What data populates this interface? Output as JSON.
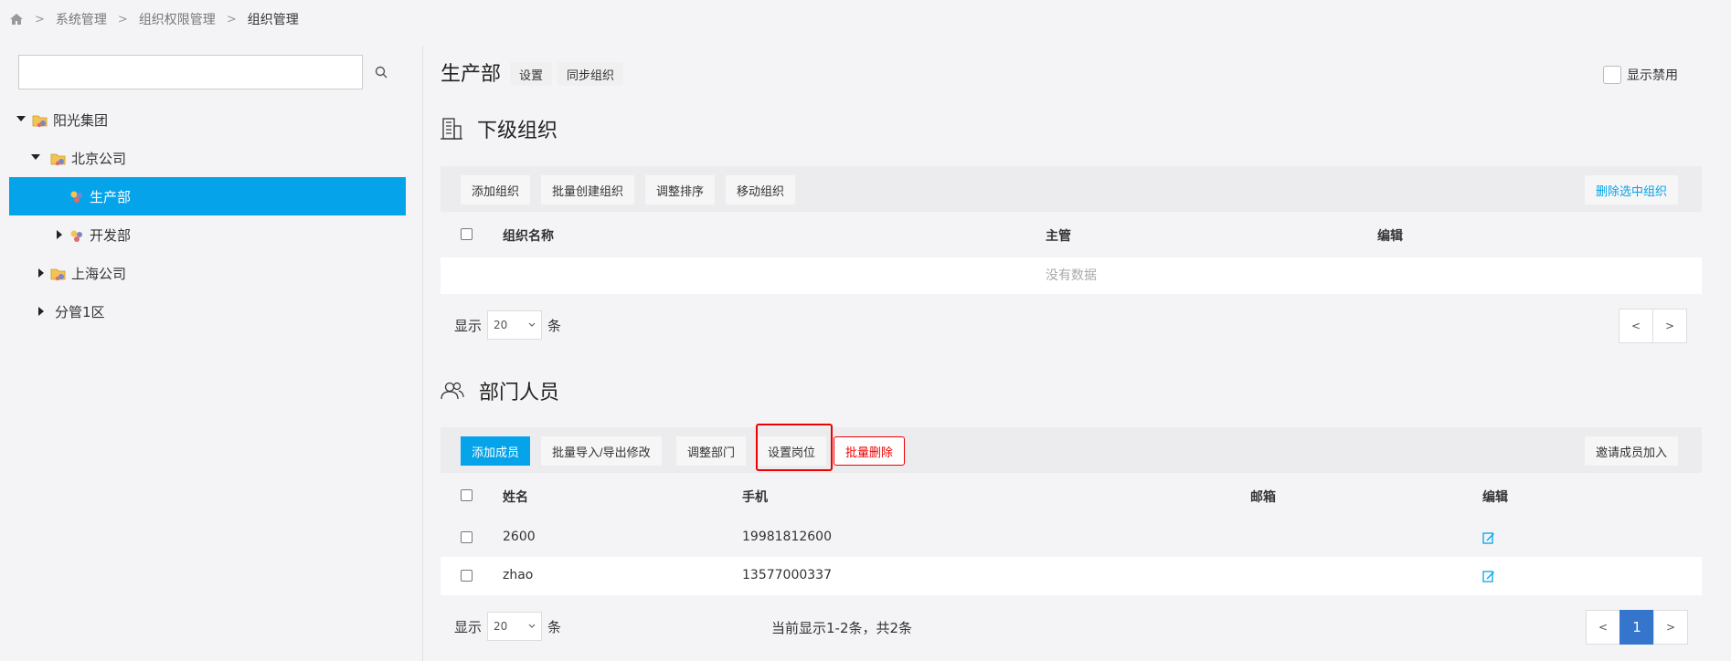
{
  "breadcrumb": {
    "items": [
      "系统管理",
      "组织权限管理",
      "组织管理"
    ],
    "separator": ">"
  },
  "left": {
    "search": {
      "value": "",
      "placeholder": ""
    },
    "tree": [
      {
        "label": "阳光集团",
        "expanded": true
      },
      {
        "label": "北京公司",
        "expanded": true
      },
      {
        "label": "生产部",
        "selected": true
      },
      {
        "label": "开发部",
        "expanded": false
      },
      {
        "label": "上海公司",
        "expanded": false
      },
      {
        "label": "分管1区",
        "expanded": false
      }
    ]
  },
  "header": {
    "title": "生产部",
    "settings_label": "设置",
    "sync_label": "同步组织",
    "show_disabled_label": "显示禁用"
  },
  "suborg": {
    "title": "下级组织",
    "buttons": [
      "添加组织",
      "批量创建组织",
      "调整排序",
      "移动组织"
    ],
    "delete_selected": "删除选中组织",
    "columns": [
      "组织名称",
      "主管",
      "编辑"
    ],
    "empty_text": "没有数据",
    "page_show": "显示",
    "page_size": "20",
    "page_unit": "条",
    "prev": "<",
    "next": ">"
  },
  "members": {
    "title": "部门人员",
    "buttons": [
      "添加成员",
      "批量导入/导出修改",
      "调整部门",
      "设置岗位",
      "批量删除"
    ],
    "invite": "邀请成员加入",
    "columns": [
      "姓名",
      "手机",
      "邮箱",
      "编辑"
    ],
    "rows": [
      {
        "name": "2600",
        "phone": "19981812600",
        "email": ""
      },
      {
        "name": "zhao",
        "phone": "13577000337",
        "email": ""
      }
    ],
    "page_show": "显示",
    "page_size": "20",
    "page_unit": "条",
    "summary": "当前显示1-2条，共2条",
    "prev": "<",
    "current_page": "1",
    "next": ">"
  },
  "colors": {
    "accent": "#05a3ea",
    "danger": "#e00000",
    "page_active": "#3575cc"
  }
}
